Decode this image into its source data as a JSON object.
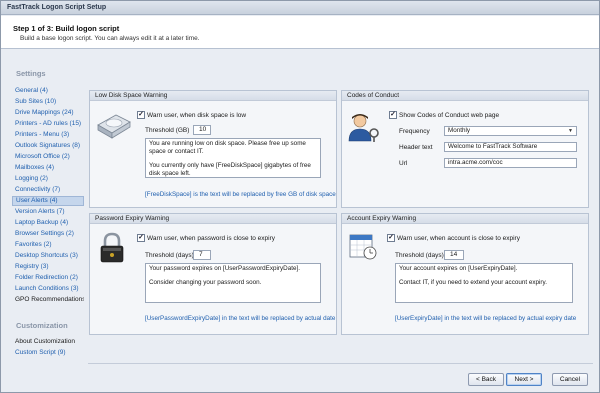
{
  "window": {
    "title": "FastTrack Logon Script Setup"
  },
  "header": {
    "step": "Step 1 of 3: Build logon script",
    "subtitle": "Build a base logon script. You can always edit it at a later time."
  },
  "sidebar": {
    "settings_heading": "Settings",
    "items": [
      "General (4)",
      "Sub Sites (10)",
      "Drive Mappings (24)",
      "Printers - AD rules (15)",
      "Printers - Menu (3)",
      "Outlook Signatures (8)",
      "Microsoft Office (2)",
      "Mailboxes (4)",
      "Logging (2)",
      "Connectivity (7)",
      "User Alerts (4)",
      "Version Alerts (7)",
      "Laptop Backup (4)",
      "Browser Settings (2)",
      "Favorites (2)",
      "Desktop Shortcuts (3)",
      "Registry (3)",
      "Folder Redirection (2)",
      "Launch Conditions (3)",
      "GPO Recommendations"
    ],
    "customization_heading": "Customization",
    "custom_items": [
      "About Customization",
      "Custom Script (9)"
    ]
  },
  "low_disk": {
    "title": "Low Disk Space Warning",
    "checkbox_label": "Warn user, when disk space is low",
    "threshold_label": "Threshold (GB)",
    "threshold_value": "10",
    "message_1": "You are running low on disk space. Please free up some space or contact IT.",
    "message_2": "You currently only have [FreeDiskSpace] gigabytes of free disk space left.",
    "note": "[FreeDiskSpace] is the text will be replaced by free GB of disk space"
  },
  "conduct": {
    "title": "Codes of Conduct",
    "checkbox_label": "Show Codes of Conduct web page",
    "frequency_label": "Frequency",
    "frequency_value": "Monthly",
    "header_label": "Header text",
    "header_value": "Welcome to FastTrack Software",
    "url_label": "Url",
    "url_value": "intra.acme.com/coc"
  },
  "password": {
    "title": "Password Expiry Warning",
    "checkbox_label": "Warn user, when password is close to expiry",
    "threshold_label": "Threshold (days)",
    "threshold_value": "7",
    "message_1": "Your password expires on [UserPasswordExpiryDate].",
    "message_2": "Consider changing your password soon.",
    "note": "[UserPasswordExpiryDate] in the text will be replaced by actual date"
  },
  "account": {
    "title": "Account Expiry Warning",
    "checkbox_label": "Warn user, when account is close to expiry",
    "threshold_label": "Threshold (days)",
    "threshold_value": "14",
    "message_1": "Your account expires on [UserExpiryDate].",
    "message_2": "Contact IT, if you need to extend your account expiry.",
    "note": "[UserExpiryDate] in the text will be replaced by actual expiry date"
  },
  "buttons": {
    "back": "< Back",
    "next": "Next >",
    "cancel": "Cancel"
  },
  "colors": {
    "accent": "#1f5fae",
    "selected": "#c5d6ec"
  }
}
